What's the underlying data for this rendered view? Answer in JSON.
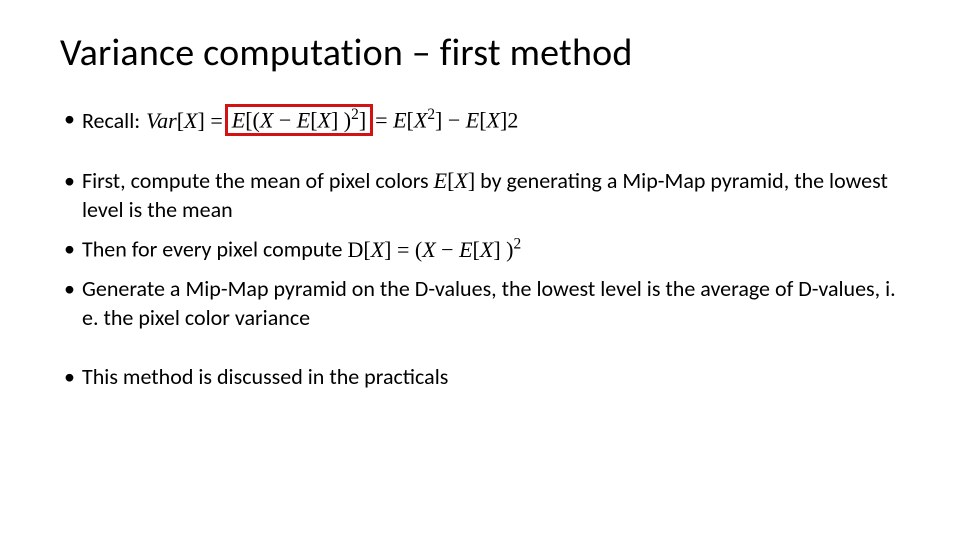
{
  "title": "Variance computation – first method",
  "bullets": {
    "b1": {
      "label": "Recall:",
      "lhs": "Var[X] =",
      "boxed": "E[(X − E[X] )²]",
      "rhs": "= E[X²] − E[X]2"
    },
    "b2": {
      "prefix": "First, compute the mean of pixel colors ",
      "math": "E[X]",
      "suffix": " by generating a Mip-Map pyramid, the lowest level is the mean"
    },
    "b3": {
      "prefix": "Then for every pixel compute ",
      "math": "D[X] = (X − E[X] )²"
    },
    "b4": {
      "text": "Generate a Mip-Map pyramid on the D-values, the lowest level is the average of D-values, i. e. the pixel color variance"
    },
    "b5": {
      "text": "This method is discussed in the practicals"
    }
  }
}
